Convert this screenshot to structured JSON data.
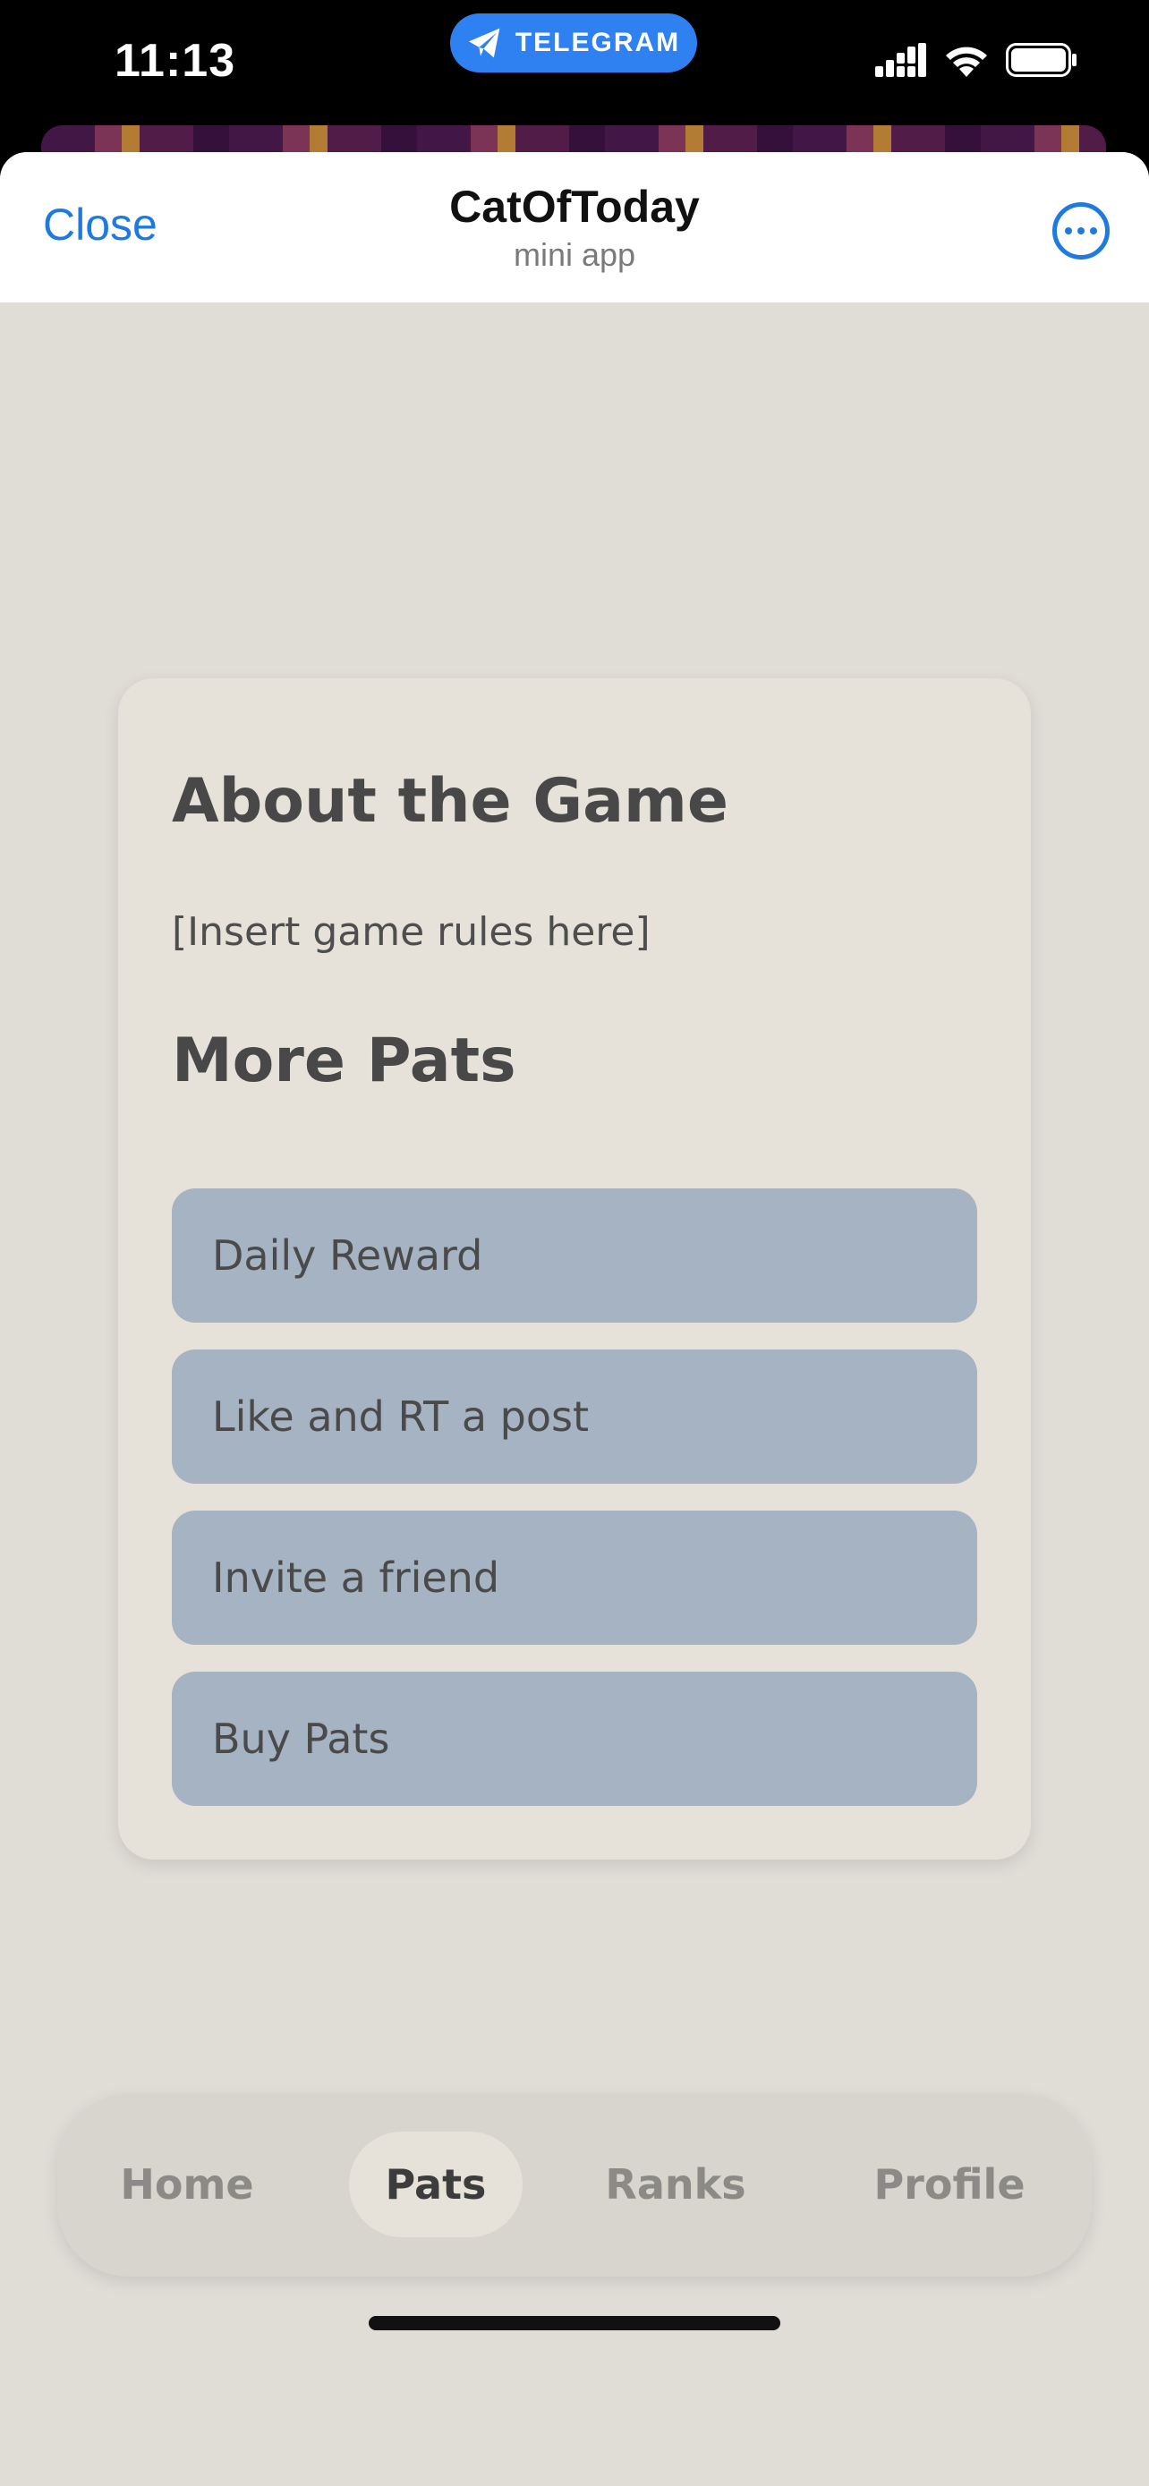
{
  "status_bar": {
    "time": "11:13",
    "telegram_label": "TELEGRAM"
  },
  "header": {
    "close_label": "Close",
    "title": "CatOfToday",
    "subtitle": "mini app"
  },
  "card": {
    "about_title": "About the Game",
    "rules_text": "[Insert game rules here]",
    "more_title": "More Pats",
    "actions": [
      {
        "label": "Daily Reward"
      },
      {
        "label": "Like and RT a post"
      },
      {
        "label": "Invite a friend"
      },
      {
        "label": "Buy Pats"
      }
    ]
  },
  "tabs": [
    {
      "label": "Home",
      "active": false
    },
    {
      "label": "Pats",
      "active": true
    },
    {
      "label": "Ranks",
      "active": false
    },
    {
      "label": "Profile",
      "active": false
    }
  ],
  "colors": {
    "accent": "#1f7ae0",
    "telegram": "#2f80f0",
    "page_bg": "#e0dcd6",
    "card_bg": "#e6e2da",
    "button_bg": "#a5b3c2",
    "tabbar_bg": "#d8d4ce"
  },
  "icons": {
    "telegram": "telegram-plane-icon",
    "signal": "cellular-signal-icon",
    "wifi": "wifi-icon",
    "battery": "battery-icon",
    "more": "more-horizontal-icon"
  }
}
